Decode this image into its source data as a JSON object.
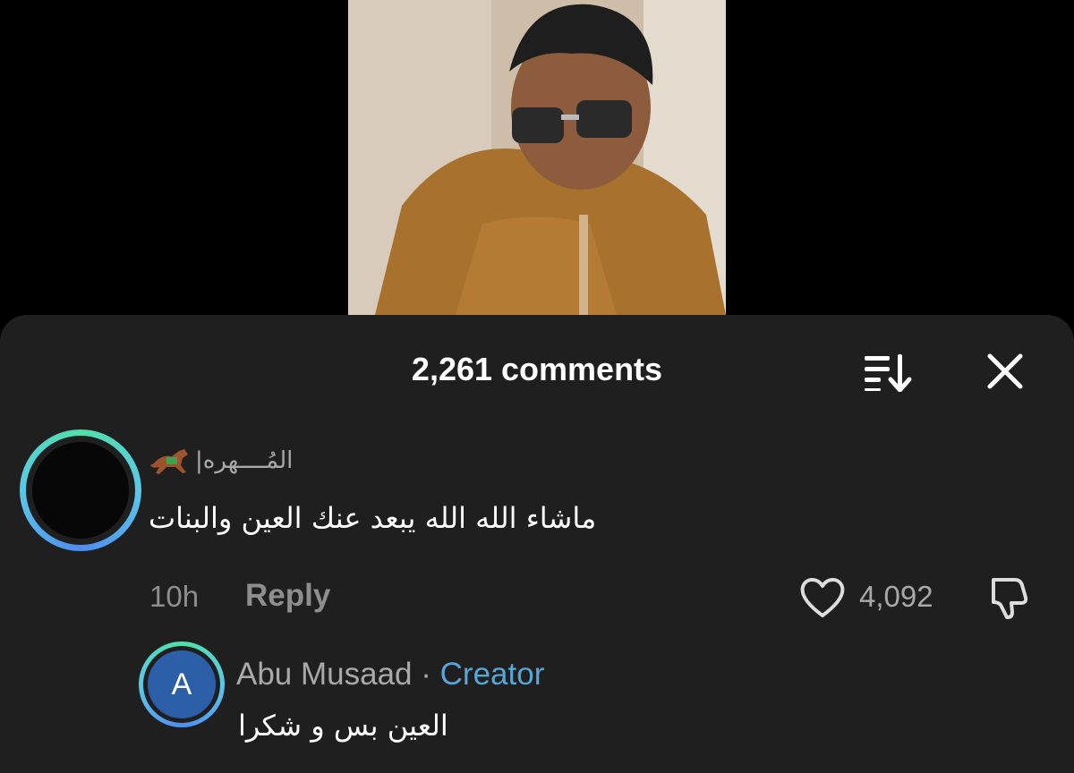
{
  "sheet": {
    "title": "2,261 comments"
  },
  "video": {
    "description_icon": "video-frame"
  },
  "icons": {
    "sort": "sort-icon",
    "close": "close-icon",
    "like": "heart-icon",
    "dislike": "thumbs-down-icon",
    "horse": "horse-emoji"
  },
  "comment": {
    "username": "المُــــهره|",
    "text": "ماشاء الله الله يبعد عنك العين والبنات",
    "time": "10h",
    "reply_label": "Reply",
    "likes": "4,092"
  },
  "reply": {
    "avatar_letter": "A",
    "author": "Abu Musaad",
    "separator": "·",
    "badge": "Creator",
    "text": "العين بس و شكرا"
  },
  "colors": {
    "sheet_bg": "#1f1f1f",
    "accent_blue": "#58a6d8",
    "muted_text": "#a9a9a9",
    "reply_avatar_bg": "#2d5fa8"
  }
}
